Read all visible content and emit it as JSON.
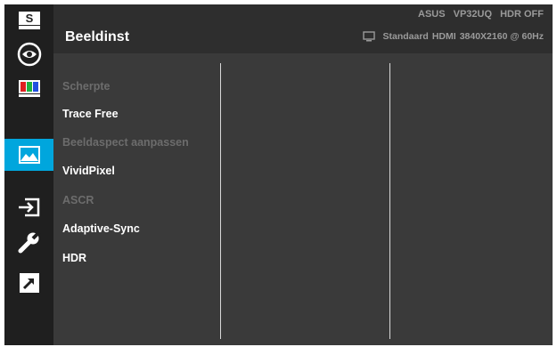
{
  "header": {
    "title": "Beeldinst",
    "model": "ASUS",
    "model_name": "VP32UQ",
    "hdr_status": "HDR OFF",
    "mode": "Standaard",
    "input": "HDMI",
    "resolution": "3840X2160 @ 60Hz"
  },
  "sidebar": {
    "items": [
      {
        "icon": "splendid-icon",
        "label": "S"
      },
      {
        "icon": "eye-icon"
      },
      {
        "icon": "color-bars-icon"
      },
      {
        "icon": "image-icon",
        "active": true
      },
      {
        "icon": "input-select-icon"
      },
      {
        "icon": "wrench-icon"
      },
      {
        "icon": "shortcut-arrow-icon"
      }
    ]
  },
  "menu": {
    "items": [
      {
        "label": "Scherpte",
        "enabled": false
      },
      {
        "label": "Trace Free",
        "enabled": true
      },
      {
        "label": "Beeldaspect aanpassen",
        "enabled": false
      },
      {
        "label": "VividPixel",
        "enabled": true
      },
      {
        "label": "ASCR",
        "enabled": false
      },
      {
        "label": "Adaptive-Sync",
        "enabled": true
      },
      {
        "label": "HDR",
        "enabled": true
      }
    ]
  },
  "colors": {
    "accent": "#00a6dd",
    "background": "#3a3a3a",
    "sidebar": "#1f1f1f",
    "text": "#ffffff",
    "disabled_text": "#6c6c6c",
    "status_text": "#9a9a9a"
  }
}
